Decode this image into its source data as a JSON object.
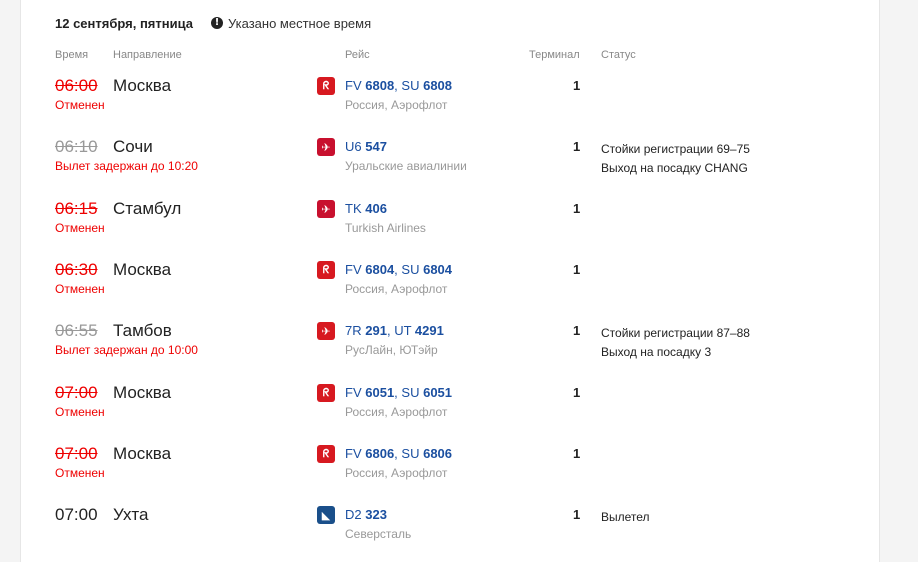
{
  "header": {
    "date": "12 сентября, пятница",
    "notice": "Указано местное время"
  },
  "columns": {
    "time": "Время",
    "direction": "Направление",
    "flight": "Рейс",
    "terminal": "Терминал",
    "status": "Статус"
  },
  "colors": {
    "cancel": "#e00000",
    "link": "#1b4fa0",
    "aeroflot": "#d71920",
    "ural": "#c8102e",
    "turkish": "#c8102e",
    "ruslain": "#d71920",
    "severstal": "#1a4f8a"
  },
  "flights": [
    {
      "time": "06:00",
      "state": "cancel",
      "city": "Москва",
      "note": "Отменен",
      "logo": "aeroflot-logo-icon",
      "codes": [
        {
          "pre": "FV",
          "num": "6808"
        },
        {
          "pre": "SU",
          "num": "6808"
        }
      ],
      "airline": "Россия, Аэрофлот",
      "terminal": "1",
      "status": []
    },
    {
      "time": "06:10",
      "state": "delay",
      "city": "Сочи",
      "note": "Вылет задержан до 10:20",
      "logo": "ural-airlines-logo-icon",
      "codes": [
        {
          "pre": "U6",
          "num": "547"
        }
      ],
      "airline": "Уральские авиалинии",
      "terminal": "1",
      "status": [
        "Стойки регистрации 69–75",
        "Выход на посадку CHANG"
      ]
    },
    {
      "time": "06:15",
      "state": "cancel",
      "city": "Стамбул",
      "note": "Отменен",
      "logo": "turkish-airlines-logo-icon",
      "codes": [
        {
          "pre": "TK",
          "num": "406"
        }
      ],
      "airline": "Turkish Airlines",
      "terminal": "1",
      "status": []
    },
    {
      "time": "06:30",
      "state": "cancel",
      "city": "Москва",
      "note": "Отменен",
      "logo": "aeroflot-logo-icon",
      "codes": [
        {
          "pre": "FV",
          "num": "6804"
        },
        {
          "pre": "SU",
          "num": "6804"
        }
      ],
      "airline": "Россия, Аэрофлот",
      "terminal": "1",
      "status": []
    },
    {
      "time": "06:55",
      "state": "delay",
      "city": "Тамбов",
      "note": "Вылет задержан до 10:00",
      "logo": "ruslain-logo-icon",
      "codes": [
        {
          "pre": "7R",
          "num": "291"
        },
        {
          "pre": "UT",
          "num": "4291"
        }
      ],
      "airline": "РусЛайн, ЮТэйр",
      "terminal": "1",
      "status": [
        "Стойки регистрации 87–88",
        "Выход на посадку 3"
      ]
    },
    {
      "time": "07:00",
      "state": "cancel",
      "city": "Москва",
      "note": "Отменен",
      "logo": "aeroflot-logo-icon",
      "codes": [
        {
          "pre": "FV",
          "num": "6051"
        },
        {
          "pre": "SU",
          "num": "6051"
        }
      ],
      "airline": "Россия, Аэрофлот",
      "terminal": "1",
      "status": []
    },
    {
      "time": "07:00",
      "state": "cancel",
      "city": "Москва",
      "note": "Отменен",
      "logo": "aeroflot-logo-icon",
      "codes": [
        {
          "pre": "FV",
          "num": "6806"
        },
        {
          "pre": "SU",
          "num": "6806"
        }
      ],
      "airline": "Россия, Аэрофлот",
      "terminal": "1",
      "status": []
    },
    {
      "time": "07:00",
      "state": "normal",
      "city": "Ухта",
      "note": "",
      "logo": "severstal-logo-icon",
      "codes": [
        {
          "pre": "D2",
          "num": "323"
        }
      ],
      "airline": "Северсталь",
      "terminal": "1",
      "status": [
        "Вылетел"
      ]
    }
  ]
}
